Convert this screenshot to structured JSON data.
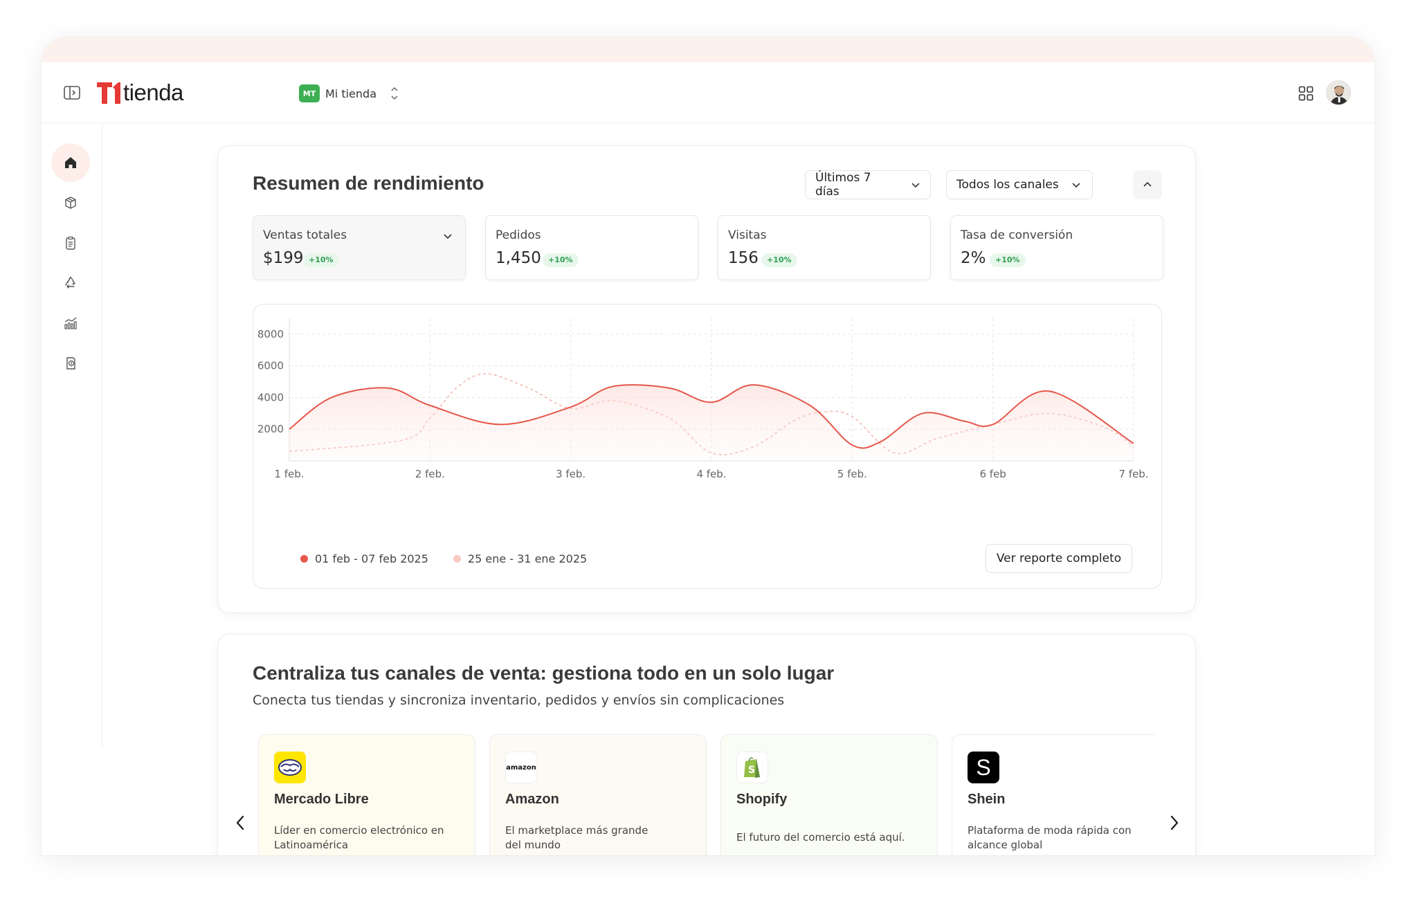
{
  "app": {
    "logo_text": "tienda",
    "brand_color": "#e53935"
  },
  "store": {
    "badge": "MT",
    "name": "Mi tienda"
  },
  "sidebar": {
    "items": [
      {
        "name": "home-icon",
        "active": true
      },
      {
        "name": "box-icon",
        "active": false
      },
      {
        "name": "clipboard-icon",
        "active": false
      },
      {
        "name": "recycle-icon",
        "active": false
      },
      {
        "name": "analytics-icon",
        "active": false
      },
      {
        "name": "billing-icon",
        "active": false
      }
    ]
  },
  "performance": {
    "title": "Resumen de rendimiento",
    "range_select": "Últimos 7 días",
    "channel_select": "Todos los canales",
    "kpis": [
      {
        "label": "Ventas totales",
        "value": "$199",
        "delta": "+10%"
      },
      {
        "label": "Pedidos",
        "value": "1,450",
        "delta": "+10%"
      },
      {
        "label": "Visitas",
        "value": "156",
        "delta": "+10%"
      },
      {
        "label": "Tasa de conversión",
        "value": "2%",
        "delta": "+10%"
      }
    ],
    "report_button": "Ver reporte completo"
  },
  "chart_data": {
    "type": "line",
    "categories": [
      "1 feb.",
      "2 feb.",
      "3 feb.",
      "4 feb.",
      "5 feb.",
      "6 feb",
      "7 feb."
    ],
    "yticks": [
      "2000",
      "4000",
      "6000",
      "8000"
    ],
    "ylim": [
      0,
      9000
    ],
    "grid": true,
    "legend_position": "bottom-left",
    "series": [
      {
        "name": "01 feb - 07 feb 2025",
        "color": "#e5574a",
        "x": [
          0,
          0.3,
          0.7,
          1.0,
          1.5,
          2.0,
          2.3,
          2.7,
          3.0,
          3.3,
          3.7,
          4.0,
          4.2,
          4.5,
          4.8,
          5.0,
          5.4,
          6.0
        ],
        "values": [
          2000,
          4000,
          4600,
          3500,
          2300,
          3400,
          4700,
          4600,
          3700,
          4800,
          3500,
          1000,
          1200,
          3000,
          2500,
          2300,
          4400,
          1100
        ]
      },
      {
        "name": "25 ene - 31 ene 2025",
        "color": "#f4b8b0",
        "x": [
          0,
          0.8,
          1.0,
          1.2,
          1.4,
          1.7,
          2.0,
          2.3,
          2.7,
          3.0,
          3.3,
          3.6,
          3.8,
          4.0,
          4.3,
          4.6,
          5.0,
          5.4,
          5.8,
          6.0
        ],
        "values": [
          600,
          1300,
          2700,
          4700,
          5500,
          4600,
          3300,
          3800,
          2700,
          500,
          900,
          2600,
          3100,
          2800,
          500,
          1400,
          2300,
          3000,
          2100,
          900
        ]
      }
    ]
  },
  "channels": {
    "title": "Centraliza tus canales de venta: gestiona todo en un solo lugar",
    "subtitle": "Conecta tus tiendas y sincroniza inventario, pedidos y envíos sin complicaciones",
    "cards": [
      {
        "name": "Mercado Libre",
        "description": "Líder en comercio electrónico en Latinoamérica",
        "logo": "mercadolibre-logo",
        "bg": "#fdfcef"
      },
      {
        "name": "Amazon",
        "description": "El marketplace más grande del mundo",
        "logo": "amazon-logo",
        "logo_text": "amazon",
        "bg": "#fdf9f3"
      },
      {
        "name": "Shopify",
        "description": "El futuro del comercio está aquí.",
        "logo": "shopify-logo",
        "bg": "#fafdf3"
      },
      {
        "name": "Shein",
        "description": "Plataforma de moda rápida con alcance global",
        "logo": "shein-logo",
        "logo_text": "S",
        "bg": "#ffffff"
      }
    ]
  }
}
